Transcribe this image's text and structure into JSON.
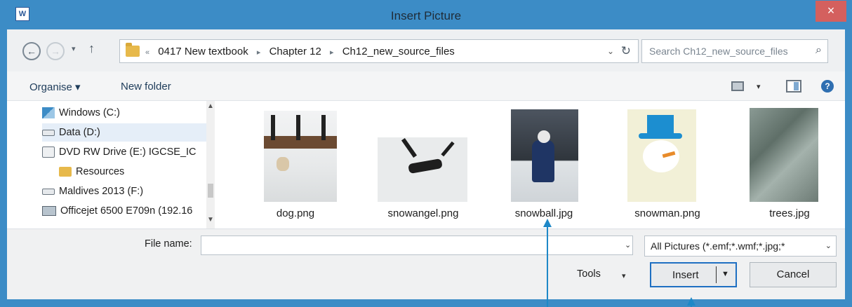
{
  "window": {
    "title": "Insert Picture",
    "app_icon": "W",
    "close_glyph": "×"
  },
  "navigation": {
    "back_glyph": "←",
    "forward_glyph": "→",
    "recent_glyph": "▾",
    "up_glyph": "↑",
    "breadcrumbs": [
      "0417 New textbook",
      "Chapter 12",
      "Ch12_new_source_files"
    ],
    "overflow_glyph": "«",
    "separator_glyph": "▸",
    "refresh_glyph": "↻"
  },
  "search": {
    "placeholder": "Search Ch12_new_source_files",
    "icon": "search-icon"
  },
  "toolbar": {
    "organise_label": "Organise ▾",
    "new_folder_label": "New folder",
    "help_glyph": "?"
  },
  "nav_pane": {
    "items": [
      {
        "label": "Windows (C:)",
        "icon": "windows-drive-icon"
      },
      {
        "label": "Data (D:)",
        "icon": "drive-icon",
        "selected": true
      },
      {
        "label": "DVD RW Drive (E:) IGCSE_IC",
        "icon": "dvd-drive-icon"
      },
      {
        "label": "Resources",
        "icon": "folder-icon"
      },
      {
        "label": "Maldives 2013 (F:)",
        "icon": "drive-icon"
      },
      {
        "label": "Officejet 6500 E709n (192.16",
        "icon": "printer-icon"
      }
    ]
  },
  "files": [
    {
      "name": "dog.png"
    },
    {
      "name": "snowangel.png"
    },
    {
      "name": "snowball.jpg"
    },
    {
      "name": "snowman.png"
    },
    {
      "name": "trees.jpg"
    }
  ],
  "footer": {
    "file_name_label": "File name:",
    "file_name_value": "",
    "file_type_value": "All Pictures (*.emf;*.wmf;*.jpg;*",
    "tools_label": "Tools",
    "insert_label": "Insert",
    "cancel_label": "Cancel"
  },
  "colors": {
    "accent": "#3c8cc6",
    "close_button": "#d4605e",
    "callout_arrow": "#1e88c7"
  }
}
